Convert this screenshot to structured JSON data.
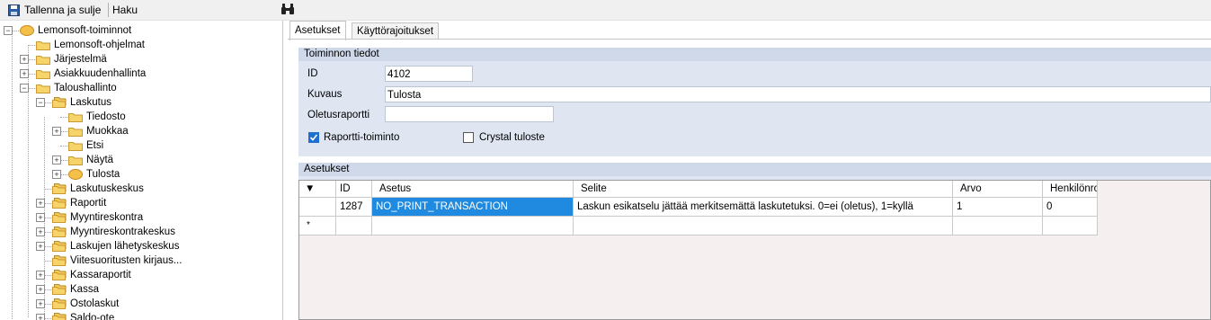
{
  "toolbar": {
    "save_label": "Tallenna ja sulje",
    "search_label": "Haku"
  },
  "tree": [
    {
      "label": "Lemonsoft-toiminnot",
      "level": 0,
      "expander": "−",
      "icon": "disk"
    },
    {
      "label": "Lemonsoft-ohjelmat",
      "level": 1,
      "expander": "",
      "icon": "folder"
    },
    {
      "label": "Järjestelmä",
      "level": 1,
      "expander": "+",
      "icon": "folder"
    },
    {
      "label": "Asiakkuudenhallinta",
      "level": 1,
      "expander": "+",
      "icon": "folder"
    },
    {
      "label": "Taloushallinto",
      "level": 1,
      "expander": "−",
      "icon": "folder"
    },
    {
      "label": "Laskutus",
      "level": 2,
      "expander": "−",
      "icon": "stack"
    },
    {
      "label": "Tiedosto",
      "level": 3,
      "expander": "",
      "icon": "folder"
    },
    {
      "label": "Muokkaa",
      "level": 3,
      "expander": "+",
      "icon": "folder"
    },
    {
      "label": "Etsi",
      "level": 3,
      "expander": "",
      "icon": "folder"
    },
    {
      "label": "Näytä",
      "level": 3,
      "expander": "+",
      "icon": "folder"
    },
    {
      "label": "Tulosta",
      "level": 3,
      "expander": "+",
      "icon": "disk"
    },
    {
      "label": "Laskutuskeskus",
      "level": 2,
      "expander": "",
      "icon": "stack"
    },
    {
      "label": "Raportit",
      "level": 2,
      "expander": "+",
      "icon": "stack"
    },
    {
      "label": "Myyntireskontra",
      "level": 2,
      "expander": "+",
      "icon": "stack"
    },
    {
      "label": "Myyntireskontrakeskus",
      "level": 2,
      "expander": "+",
      "icon": "stack"
    },
    {
      "label": "Laskujen lähetyskeskus",
      "level": 2,
      "expander": "+",
      "icon": "stack"
    },
    {
      "label": "Viitesuoritusten kirjaus...",
      "level": 2,
      "expander": "",
      "icon": "stack"
    },
    {
      "label": "Kassaraportit",
      "level": 2,
      "expander": "+",
      "icon": "stack"
    },
    {
      "label": "Kassa",
      "level": 2,
      "expander": "+",
      "icon": "stack"
    },
    {
      "label": "Ostolaskut",
      "level": 2,
      "expander": "+",
      "icon": "stack"
    },
    {
      "label": "Saldo-ote",
      "level": 2,
      "expander": "+",
      "icon": "stack"
    }
  ],
  "tabs": {
    "settings": "Asetukset",
    "restrictions": "Käyttörajoitukset"
  },
  "function_info": {
    "title": "Toiminnon tiedot",
    "id_label": "ID",
    "id_value": "4102",
    "description_label": "Kuvaus",
    "description_value": "Tulosta",
    "default_report_label": "Oletusraportti",
    "default_report_value": "",
    "report_function_label": "Raportti-toiminto",
    "report_function_checked": true,
    "crystal_label": "Crystal tuloste",
    "crystal_checked": false
  },
  "settings_grid": {
    "title": "Asetukset",
    "columns": [
      "ID",
      "Asetus",
      "Selite",
      "Arvo",
      "Henkilönro"
    ],
    "rows": [
      {
        "id": "1287",
        "setting": "NO_PRINT_TRANSACTION",
        "description": "Laskun esikatselu jättää merkitsemättä laskutetuksi. 0=ei (oletus), 1=kyllä",
        "value": "1",
        "person": "0"
      }
    ],
    "new_row_marker": "*",
    "header_marker": "▼"
  }
}
